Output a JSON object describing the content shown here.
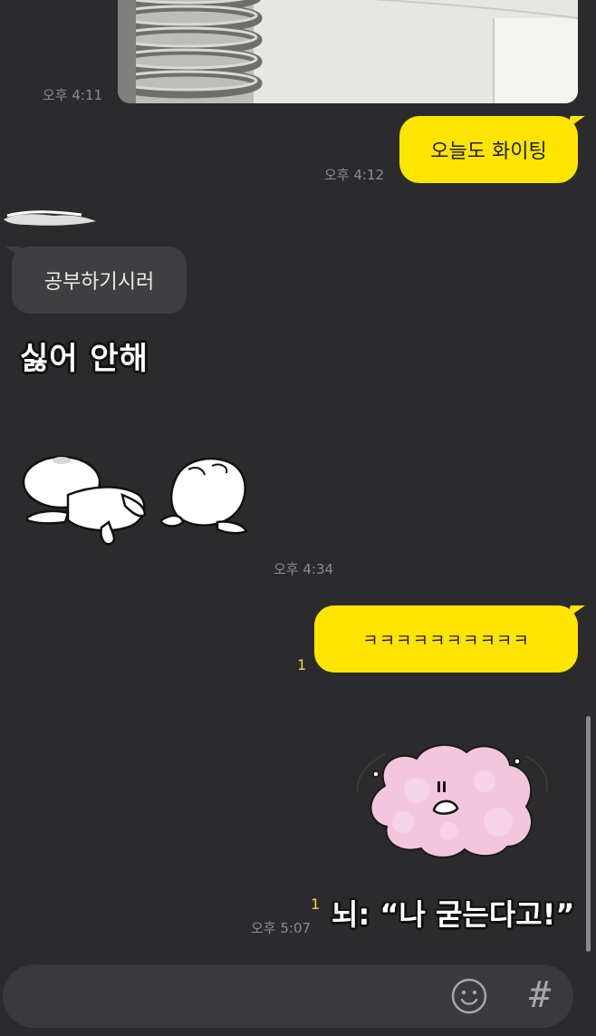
{
  "messages": [
    {
      "type": "photo",
      "time": "오후 4:11"
    },
    {
      "type": "text",
      "from": "me",
      "text": "오늘도 화이팅",
      "time": "오후 4:12"
    },
    {
      "type": "text",
      "from": "other",
      "text": "공부하기시러"
    },
    {
      "type": "sticker",
      "from": "other",
      "caption": "싫어 안해",
      "time": "오후 4:34"
    },
    {
      "type": "text",
      "from": "me",
      "text": "ㅋㅋㅋㅋㅋㅋㅋㅋㅋㅋ",
      "unread": "1"
    },
    {
      "type": "sticker",
      "from": "me",
      "caption": "뇌: “나 굳는다고!”",
      "unread": "1",
      "time": "오후 5:07"
    }
  ],
  "input": {
    "placeholder": "",
    "emoji_icon": "emoji-icon",
    "hash_icon": "#"
  },
  "colors": {
    "background": "#2b2b2d",
    "my_bubble": "#fee500",
    "other_bubble": "#3f3f42",
    "unread": "#f6d63a"
  }
}
